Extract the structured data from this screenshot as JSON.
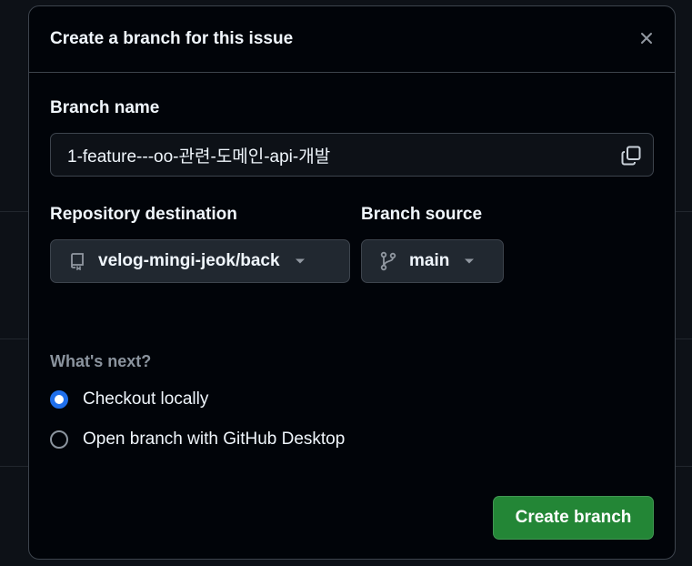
{
  "dialog": {
    "title": "Create a branch for this issue",
    "close_icon": "close-icon"
  },
  "branch_name": {
    "label": "Branch name",
    "value": "1-feature---oo-관련-도메인-api-개발",
    "copy_icon": "copy-icon"
  },
  "repository": {
    "label": "Repository destination",
    "value": "velog-mingi-jeok/back",
    "icon": "repo-icon"
  },
  "branch_source": {
    "label": "Branch source",
    "value": "main",
    "icon": "git-branch-icon"
  },
  "whats_next": {
    "label": "What's next?",
    "options": [
      {
        "label": "Checkout locally",
        "selected": true
      },
      {
        "label": "Open branch with GitHub Desktop",
        "selected": false
      }
    ]
  },
  "actions": {
    "create_label": "Create branch"
  },
  "colors": {
    "accent_blue": "#1f6feb",
    "primary_green": "#238636",
    "background": "#010409"
  }
}
